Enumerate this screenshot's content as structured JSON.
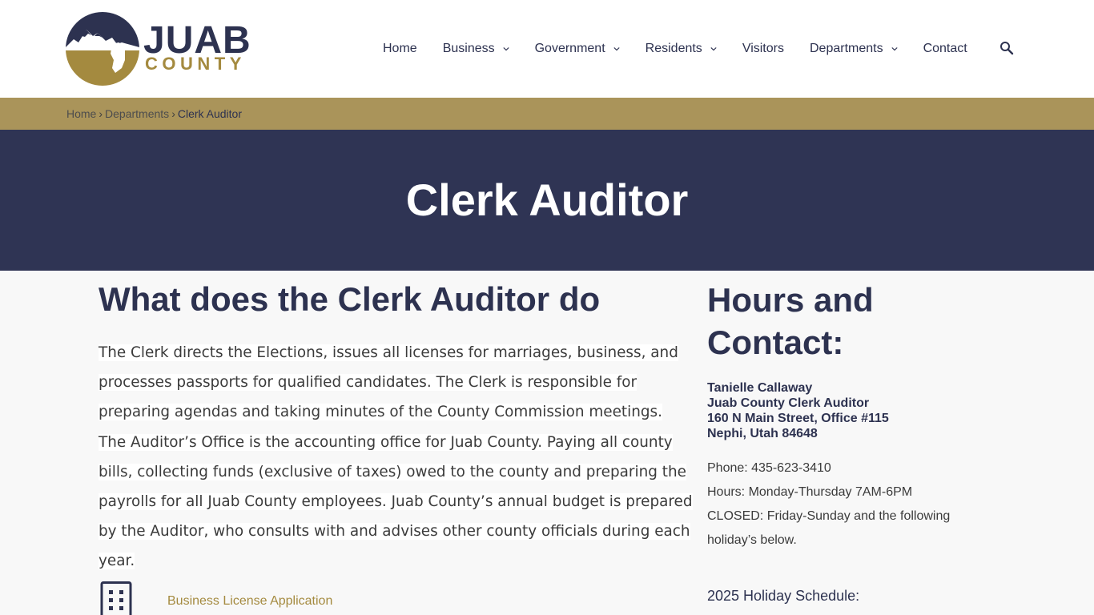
{
  "logo": {
    "word": "JUAB",
    "sub": "COUNTY",
    "colors": {
      "navy": "#2d3250",
      "gold": "#a48a3f"
    }
  },
  "nav": {
    "items": [
      {
        "label": "Home",
        "dropdown": false
      },
      {
        "label": "Business",
        "dropdown": true
      },
      {
        "label": "Government",
        "dropdown": true
      },
      {
        "label": "Residents",
        "dropdown": true
      },
      {
        "label": "Visitors",
        "dropdown": false
      },
      {
        "label": "Departments",
        "dropdown": true
      },
      {
        "label": "Contact",
        "dropdown": false
      }
    ],
    "search_icon": "search-icon"
  },
  "breadcrumb": {
    "items": [
      "Home",
      "Departments",
      "Clerk Auditor"
    ],
    "separator": "›"
  },
  "hero": {
    "title": "Clerk Auditor",
    "bg_color": "#2f3454"
  },
  "main": {
    "heading": "What does the Clerk Auditor do",
    "paragraph": "The Clerk directs the Elections, issues all licenses for marriages, business, and processes passports for qualified candidates. The Clerk is responsible for preparing agendas and taking minutes of the County Commission meetings. The Auditor’s Office is the accounting office for Juab County. Paying all county bills, collecting funds (exclusive of taxes) owed to the county and preparing the payrolls for all Juab County employees. Juab County’s annual budget is prepared by the Auditor, who consults with and advises other county officials during each year.",
    "documents": [
      {
        "icon": "building-icon",
        "label": "Business License Application"
      }
    ]
  },
  "sidebar": {
    "heading": "Hours and Contact:",
    "contact": {
      "name": "Tanielle Callaway",
      "title": "Juab County Clerk Auditor",
      "address1": "160 N Main Street, Office #115",
      "address2": "Nephi, Utah 84648"
    },
    "phone": "Phone: 435-623-3410",
    "hours": "Hours: Monday-Thursday 7AM-6PM",
    "closed": "CLOSED: Friday-Sunday and the following holiday’s below.",
    "holiday_title": "2025 Holiday Schedule:"
  },
  "colors": {
    "accent_gold": "#aa945a",
    "navy": "#2d3250"
  }
}
